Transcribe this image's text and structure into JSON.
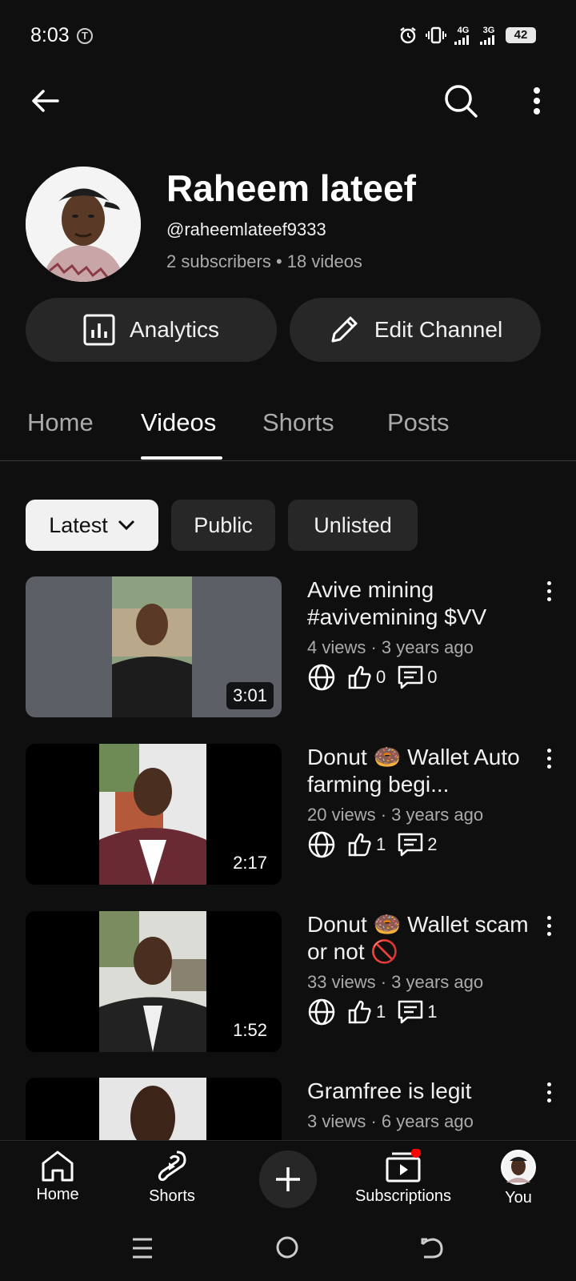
{
  "status": {
    "time": "8:03",
    "net1": "4G",
    "net2": "3G",
    "battery": "42"
  },
  "channel": {
    "name": "Raheem lateef",
    "handle": "@raheemlateef9333",
    "stats": "2 subscribers • 18 videos"
  },
  "actions": {
    "analytics": "Analytics",
    "edit": "Edit Channel"
  },
  "tabs": [
    {
      "label": "Home"
    },
    {
      "label": "Videos"
    },
    {
      "label": "Shorts"
    },
    {
      "label": "Posts"
    }
  ],
  "filters": {
    "latest": "Latest",
    "public": "Public",
    "unlisted": "Unlisted"
  },
  "videos": [
    {
      "title": "Avive mining #avivemining $VV",
      "meta": "4 views · 3 years ago",
      "likes": "0",
      "comments": "0",
      "duration": "3:01"
    },
    {
      "title": "Donut 🍩 Wallet Auto farming begi...",
      "meta": "20 views · 3 years ago",
      "likes": "1",
      "comments": "2",
      "duration": "2:17"
    },
    {
      "title": "Donut 🍩 Wallet scam or not 🚫",
      "meta": "33 views · 3 years ago",
      "likes": "1",
      "comments": "1",
      "duration": "1:52"
    },
    {
      "title": "Gramfree is legit",
      "meta": "3 views · 6 years ago"
    }
  ],
  "nav": {
    "home": "Home",
    "shorts": "Shorts",
    "subscriptions": "Subscriptions",
    "you": "You"
  },
  "colors": {
    "background": "#0f0f0f",
    "surface": "#272727",
    "notification": "#ff0000"
  }
}
